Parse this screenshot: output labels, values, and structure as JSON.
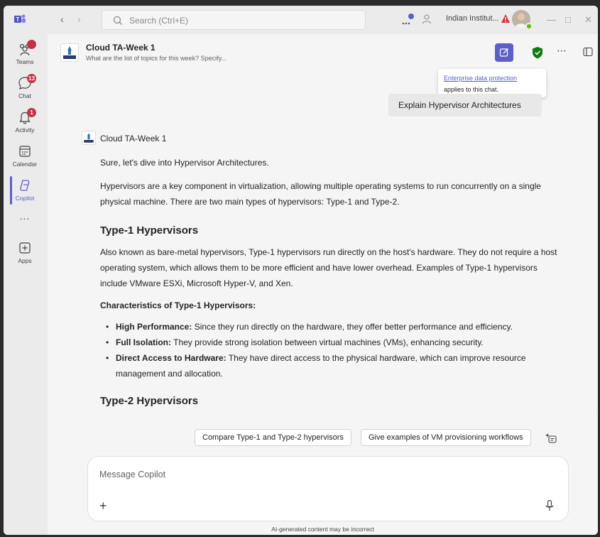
{
  "titlebar": {
    "search_placeholder": "Search (Ctrl+E)",
    "org_name": "Indian Institut..."
  },
  "rail": {
    "items": [
      {
        "label": "Teams",
        "badge": ""
      },
      {
        "label": "Chat",
        "badge": "13"
      },
      {
        "label": "Activity",
        "badge": "1"
      },
      {
        "label": "Calendar",
        "badge": ""
      },
      {
        "label": "Copilot",
        "badge": ""
      },
      {
        "label": "Apps",
        "badge": ""
      }
    ],
    "more": "..."
  },
  "header": {
    "title": "Cloud TA-Week 1",
    "subtitle": "What are the list of topics for this week? Specify..."
  },
  "tooltip": {
    "link": "Enterprise data protection",
    "text": "applies to this chat."
  },
  "user_message": "Explain Hypervisor Architectures",
  "response": {
    "sender": "Cloud TA-Week 1",
    "intro": "Sure, let's dive into Hypervisor Architectures.",
    "para1": "Hypervisors are a key component in virtualization, allowing multiple operating systems to run concurrently on a single physical machine. There are two main types of hypervisors: Type-1 and Type-2.",
    "h_type1": "Type-1 Hypervisors",
    "para2": "Also known as bare-metal hypervisors, Type-1 hypervisors run directly on the host's hardware. They do not require a host operating system, which allows them to be more efficient and have lower overhead. Examples of Type-1 hypervisors include VMware ESXi, Microsoft Hyper-V, and Xen.",
    "h_char": "Characteristics of Type-1 Hypervisors:",
    "bullets": [
      {
        "term": "High Performance:",
        "text": " Since they run directly on the hardware, they offer better performance and efficiency."
      },
      {
        "term": "Full Isolation:",
        "text": " They provide strong isolation between virtual machines (VMs), enhancing security."
      },
      {
        "term": "Direct Access to Hardware:",
        "text": " They have direct access to the physical hardware, which can improve resource management and allocation."
      }
    ],
    "h_type2": "Type-2 Hypervisors"
  },
  "suggestions": [
    "Compare Type-1 and Type-2 hypervisors",
    "Give examples of VM provisioning workflows"
  ],
  "composer": {
    "placeholder": "Message Copilot",
    "plus": "+"
  },
  "disclaimer": "AI-generated content may be incorrect",
  "colors": {
    "accent": "#5b5fc7",
    "badge": "#c4314b",
    "shield": "#107c10",
    "presence": "#6bb700"
  }
}
